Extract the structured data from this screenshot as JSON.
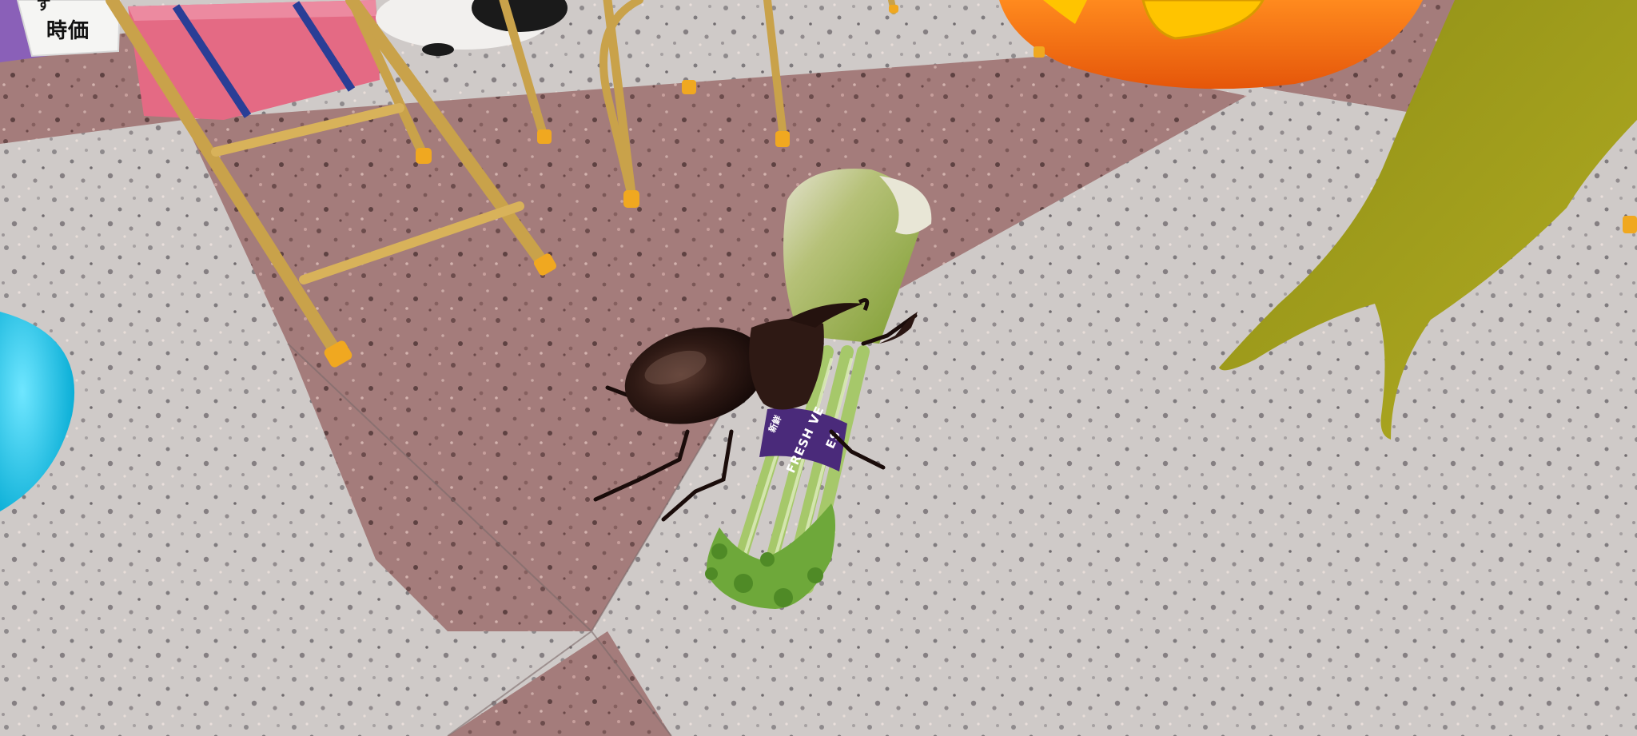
{
  "scene": {
    "price_sign": {
      "top_text": "ず",
      "text": "時価"
    },
    "vegetable_band": {
      "text": "FRESH VE",
      "side_text": "ES",
      "small_text": "新鮮"
    }
  },
  "colors": {
    "floor_gray": "#c9c4c2",
    "floor_red": "#8f6a68",
    "chair_gold": "#c9a24a",
    "chair_feet": "#f0a820",
    "pumpkin_orange": "#f07010",
    "cloth_green": "#9a9a1c",
    "beetle_brown": "#2a1612",
    "radish_green": "#8fae3a",
    "band_purple": "#4a2a7a",
    "bag_pink": "#e46a84",
    "cyan_object": "#18c8e8"
  },
  "icons": [
    "rhinoceros-beetle-icon",
    "daikon-radish-icon",
    "folding-chair-icon",
    "pumpkin-icon",
    "green-cloth-icon",
    "pink-bag-icon"
  ]
}
